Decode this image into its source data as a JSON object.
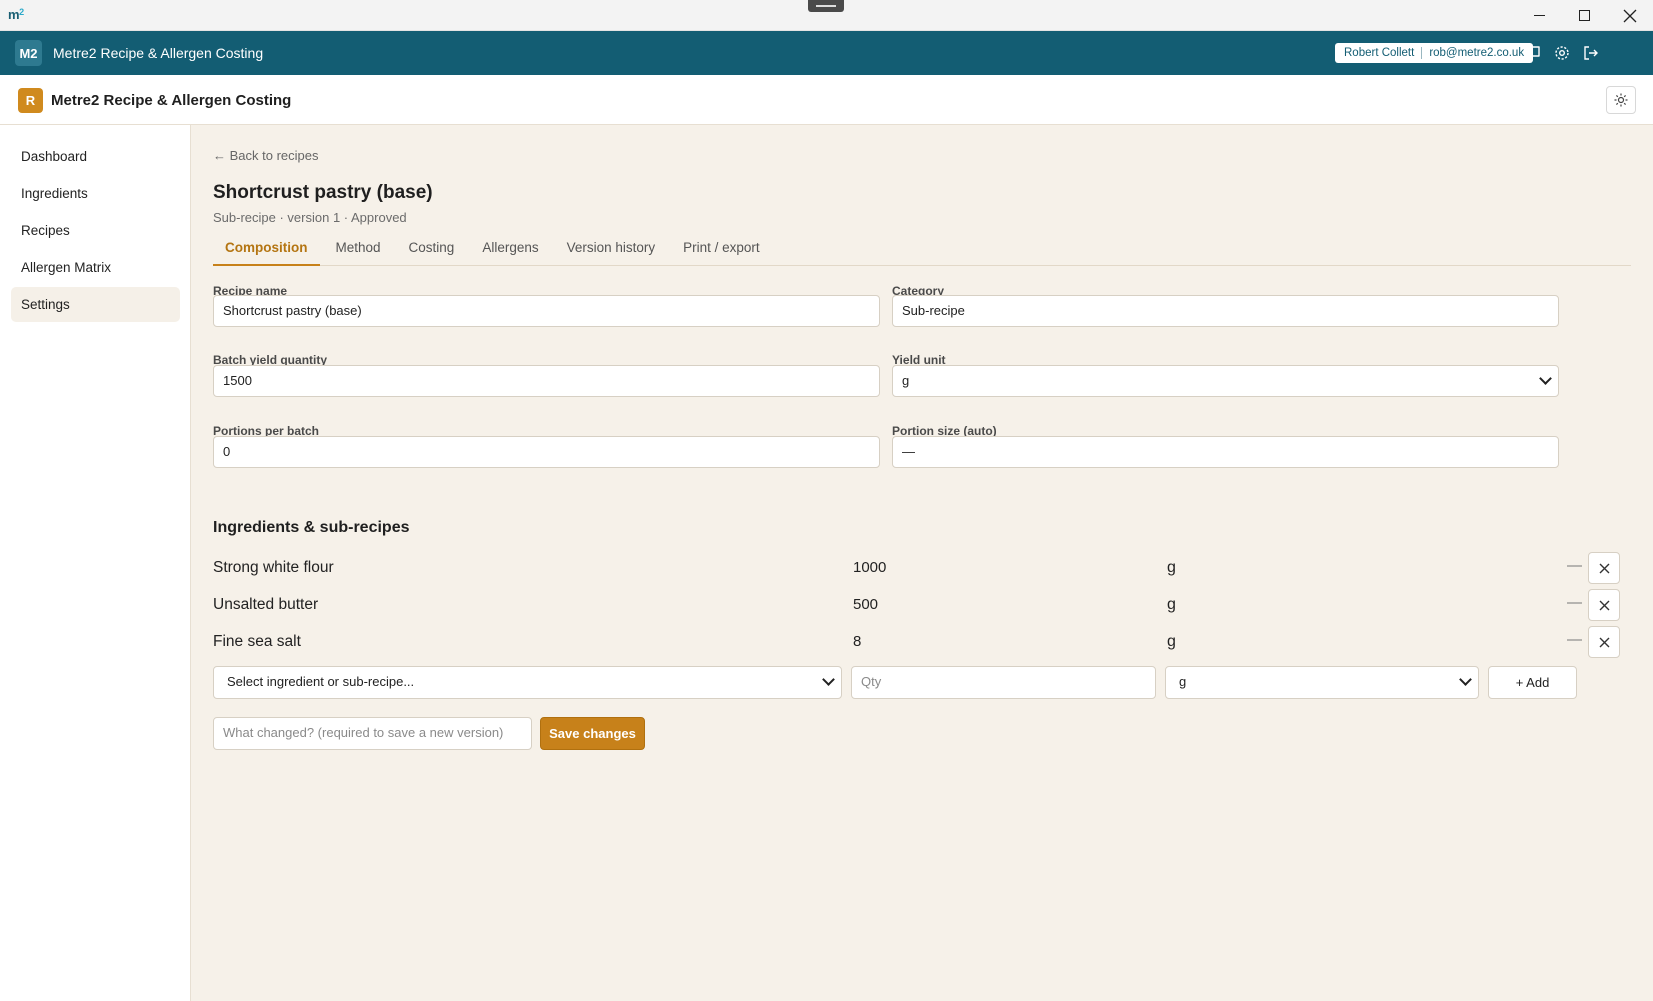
{
  "os": {
    "logo_main": "m",
    "logo_sub": "2"
  },
  "app_header": {
    "badge": "M2",
    "title": "Metre2 Recipe & Allergen Costing",
    "user_name": "Robert Collett",
    "user_email": "rob@metre2.co.uk"
  },
  "sub_header": {
    "badge": "R",
    "title": "Metre2 Recipe & Allergen Costing"
  },
  "sidebar": {
    "items": [
      {
        "label": "Dashboard"
      },
      {
        "label": "Ingredients"
      },
      {
        "label": "Recipes"
      },
      {
        "label": "Allergen Matrix"
      },
      {
        "label": "Settings"
      }
    ]
  },
  "page": {
    "back_link": "← Back to recipes",
    "title": "Shortcrust pastry (base)",
    "subtitle": "Sub-recipe · version 1 · Approved",
    "tabs": [
      {
        "label": "Composition"
      },
      {
        "label": "Method"
      },
      {
        "label": "Costing"
      },
      {
        "label": "Allergens"
      },
      {
        "label": "Version history"
      },
      {
        "label": "Print / export"
      }
    ]
  },
  "form": {
    "recipe_name_label": "Recipe name",
    "recipe_name_value": "Shortcrust pastry (base)",
    "category_label": "Category",
    "category_value": "Sub-recipe",
    "batch_yield_label": "Batch yield quantity",
    "batch_yield_value": "1500",
    "yield_unit_label": "Yield unit",
    "yield_unit_value": "g",
    "portions_label": "Portions per batch",
    "portions_value": "0",
    "portion_size_label": "Portion size (auto)",
    "portion_size_value": "—"
  },
  "ingredients": {
    "title": "Ingredients & sub-recipes",
    "rows": [
      {
        "name": "Strong white flour",
        "qty": "1000",
        "unit": "g",
        "cost": "—"
      },
      {
        "name": "Unsalted butter",
        "qty": "500",
        "unit": "g",
        "cost": "—"
      },
      {
        "name": "Fine sea salt",
        "qty": "8",
        "unit": "g",
        "cost": "—"
      }
    ],
    "add_select_placeholder": "Select ingredient or sub-recipe...",
    "qty_placeholder": "Qty",
    "add_unit_value": "g",
    "add_label": "+ Add"
  },
  "save": {
    "change_placeholder": "What changed? (required to save a new version)",
    "save_label": "Save changes"
  },
  "colors": {
    "header_teal": "#135d73",
    "accent_amber": "#c7811a",
    "main_bg": "#f6f1e9"
  }
}
